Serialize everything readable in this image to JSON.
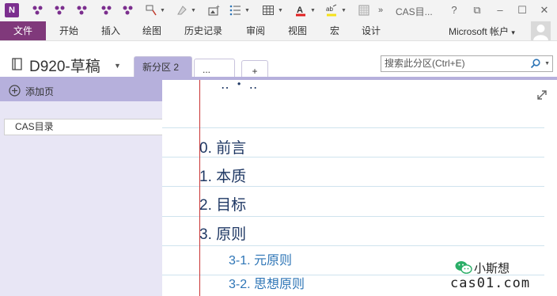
{
  "title_bar": {
    "app_logo_letter": "N",
    "window_title": "CAS目...",
    "help_button": "?",
    "restore_button": "⧉",
    "minimize_button": "–",
    "maximize_button": "☐",
    "close_button": "✕",
    "more_tools": "»"
  },
  "ribbon": {
    "tabs": [
      "文件",
      "开始",
      "插入",
      "绘图",
      "历史记录",
      "审阅",
      "视图",
      "宏",
      "设计"
    ],
    "account_label": "Microsoft 帐户",
    "account_dropdown": "▾"
  },
  "notebook": {
    "name": "D920-草稿",
    "dropdown": "▼",
    "sections": {
      "active": "新分区 2",
      "more": "...",
      "add": "+"
    },
    "search_placeholder": "搜索此分区(Ctrl+E)"
  },
  "page_pane": {
    "add_page_label": "添加页",
    "pages": [
      "CAS目录"
    ]
  },
  "note": {
    "headings": [
      "0. 前言",
      "1. 本质",
      "2. 目标",
      "3. 原则"
    ],
    "subheadings": [
      "3-1. 元原则",
      "3-2. 思想原则"
    ]
  },
  "watermark": {
    "name": "小斯想",
    "site": "cas01.com"
  },
  "colors": {
    "file_tab": "#80397b",
    "section_accent": "#b6b0dc",
    "heading_text": "#1f3864",
    "subheading_text": "#2e75b6",
    "margin_line": "#c83232"
  }
}
